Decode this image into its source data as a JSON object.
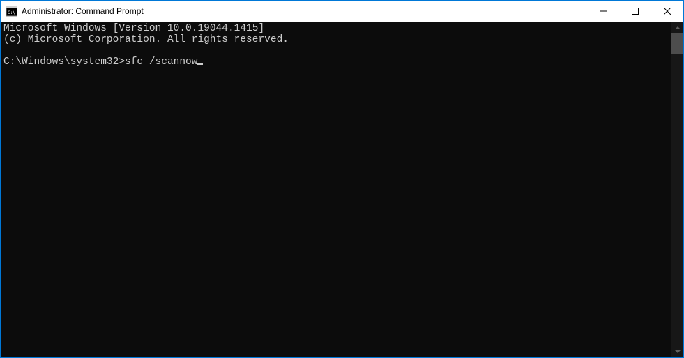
{
  "titlebar": {
    "title": "Administrator: Command Prompt"
  },
  "terminal": {
    "line1": "Microsoft Windows [Version 10.0.19044.1415]",
    "line2": "(c) Microsoft Corporation. All rights reserved.",
    "blank": "",
    "prompt": "C:\\Windows\\system32>",
    "command": "sfc /scannow"
  }
}
